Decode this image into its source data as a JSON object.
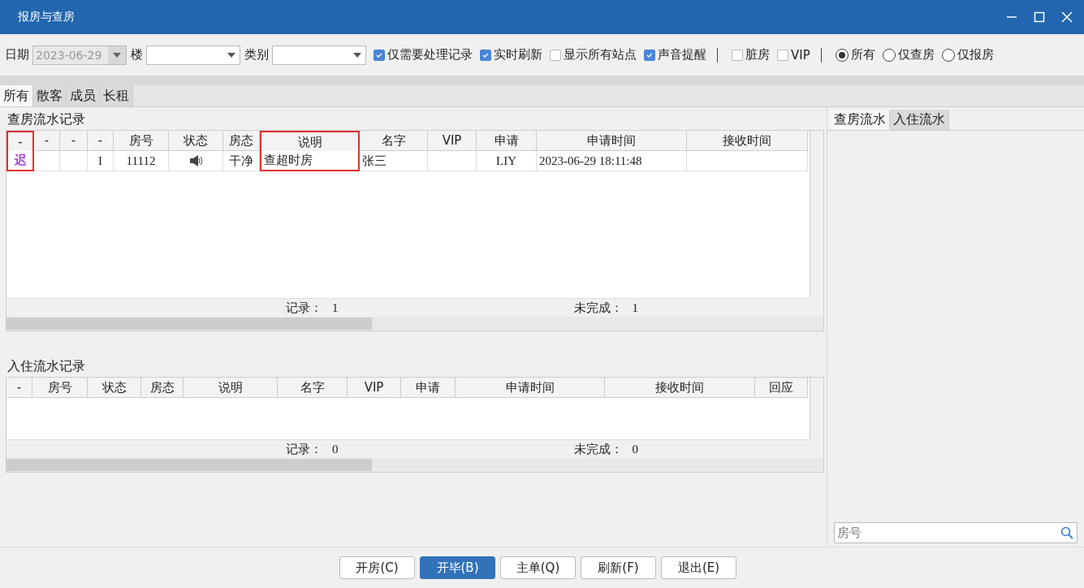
{
  "window": {
    "title": "报房与查房"
  },
  "toolbar": [
    {
      "kind": "date",
      "label": "日期",
      "value": "2023-06-29",
      "disabled": true
    },
    {
      "kind": "dropdown",
      "label": "楼"
    },
    {
      "kind": "dropdown",
      "label": "类别"
    },
    {
      "kind": "checkbox",
      "label": "仅需要处理记录",
      "checked": true
    },
    {
      "kind": "checkbox",
      "label": "实时刷新",
      "checked": true
    },
    {
      "kind": "checkbox",
      "label": "显示所有站点",
      "checked": false
    },
    {
      "kind": "checkbox",
      "label": "声音提醒",
      "checked": true
    },
    {
      "kind": "separator"
    },
    {
      "kind": "checkbox",
      "label": "脏房",
      "checked": false
    },
    {
      "kind": "checkbox",
      "label": "VIP",
      "checked": false
    },
    {
      "kind": "separator"
    },
    {
      "kind": "radio",
      "label": "所有",
      "selected": true
    },
    {
      "kind": "radio",
      "label": "仅查房",
      "selected": false
    },
    {
      "kind": "radio",
      "label": "仅报房",
      "selected": false
    }
  ],
  "tabs": [
    {
      "label": "所有",
      "selected": true
    },
    {
      "label": "散客",
      "selected": false
    },
    {
      "label": "成员",
      "selected": false
    },
    {
      "label": "长租",
      "selected": false
    }
  ],
  "check_table": {
    "title": "查房流水记录",
    "columns": [
      {
        "label": "-",
        "highlighted": true
      },
      {
        "label": "-",
        "highlighted": false
      },
      {
        "label": "-",
        "highlighted": false
      },
      {
        "label": "-",
        "highlighted": false
      },
      {
        "label": "房号",
        "highlighted": false
      },
      {
        "label": "状态",
        "highlighted": false
      },
      {
        "label": "房态",
        "highlighted": false
      },
      {
        "label": "说明",
        "highlighted": true
      },
      {
        "label": "名字",
        "highlighted": false
      },
      {
        "label": "VIP",
        "highlighted": false
      },
      {
        "label": "申请",
        "highlighted": false
      },
      {
        "label": "申请时间",
        "highlighted": false
      },
      {
        "label": "接收时间",
        "highlighted": false
      }
    ],
    "rows": [
      {
        "cells": [
          {
            "kind": "flag",
            "text": "迟"
          },
          {
            "kind": "text"
          },
          {
            "kind": "text"
          },
          {
            "kind": "text",
            "text": "I"
          },
          {
            "kind": "text",
            "text": "11112"
          },
          {
            "kind": "speaker"
          },
          {
            "kind": "text",
            "text": "干净"
          },
          {
            "kind": "left",
            "text": "查超时房"
          },
          {
            "kind": "left",
            "text": "张三"
          },
          {
            "kind": "text"
          },
          {
            "kind": "text",
            "text": "LIY"
          },
          {
            "kind": "left",
            "text": "2023-06-29 18:11:48"
          },
          {
            "kind": "text"
          }
        ]
      }
    ],
    "footer": {
      "records_label": "记录：",
      "records": "1",
      "pending_label": "未完成：",
      "pending": "1"
    }
  },
  "checkin_table": {
    "title": "入住流水记录",
    "columns": [
      {
        "label": "-",
        "highlighted": false
      },
      {
        "label": "房号",
        "highlighted": false
      },
      {
        "label": "状态",
        "highlighted": false
      },
      {
        "label": "房态",
        "highlighted": false
      },
      {
        "label": "说明",
        "highlighted": false
      },
      {
        "label": "名字",
        "highlighted": false
      },
      {
        "label": "VIP",
        "highlighted": false
      },
      {
        "label": "申请",
        "highlighted": false
      },
      {
        "label": "申请时间",
        "highlighted": false
      },
      {
        "label": "接收时间",
        "highlighted": false
      },
      {
        "label": "回应",
        "highlighted": false
      }
    ],
    "footer": {
      "records_label": "记录：",
      "records": "0",
      "pending_label": "未完成：",
      "pending": "0"
    }
  },
  "side_tabs": [
    {
      "label": "查房流水",
      "selected": true
    },
    {
      "label": "入住流水",
      "selected": false
    }
  ],
  "search": {
    "placeholder": "房号"
  },
  "buttons": [
    {
      "label": "开房(C)",
      "primary": false
    },
    {
      "label": "开毕(B)",
      "primary": true
    },
    {
      "label": "主单(Q)",
      "primary": false
    },
    {
      "label": "刷新(F)",
      "primary": false
    },
    {
      "label": "退出(E)",
      "primary": false
    }
  ]
}
